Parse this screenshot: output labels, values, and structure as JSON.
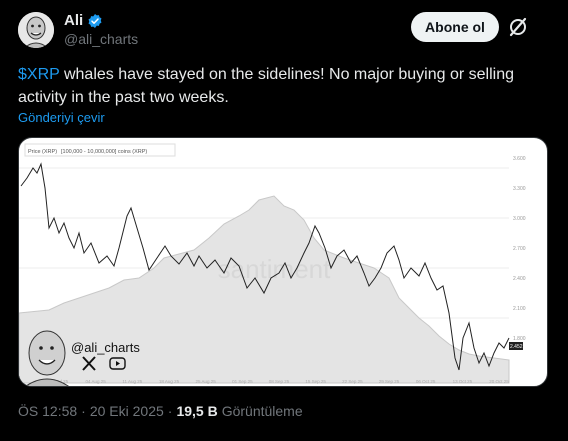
{
  "author": {
    "display_name": "Ali",
    "handle": "@ali_charts",
    "verified": true
  },
  "actions": {
    "follow_label": "Abone ol",
    "grok_icon": "grok-icon"
  },
  "post": {
    "cashtag": "$XRP",
    "text": " whales have stayed on the sidelines! No major buying or selling activity in the past two weeks.",
    "translate_label": "Gönderiyi çevir"
  },
  "media": {
    "legend_price": "Price (XRP)",
    "legend_supply": "[100,000 - 10,000,000] coins (XRP)",
    "watermark": "santiment",
    "overlay_handle": "@ali_charts",
    "price_label": "2.452",
    "x_ticks": [
      "28 Jul 25",
      "04 Aug 25",
      "11 Aug 25",
      "18 Aug 25",
      "25 Aug 25",
      "01 Sep 25",
      "08 Sep 25",
      "15 Sep 25",
      "22 Sep 25",
      "29 Sep 25",
      "06 Oct 25",
      "13 Oct 25",
      "20 Oct 25"
    ],
    "y_right_ticks": [
      "3.600",
      "3.300",
      "3.000",
      "2.700",
      "2.400",
      "2.100",
      "1.800"
    ]
  },
  "footer": {
    "time": "ÖS 12:58",
    "separator": "·",
    "date": "20 Eki 2025",
    "views_count": "19,5 B",
    "views_label": "Görüntüleme"
  },
  "colors": {
    "accent": "#1d9bf0",
    "text": "#e7e9ea",
    "muted": "#71767b",
    "background": "#000000"
  }
}
